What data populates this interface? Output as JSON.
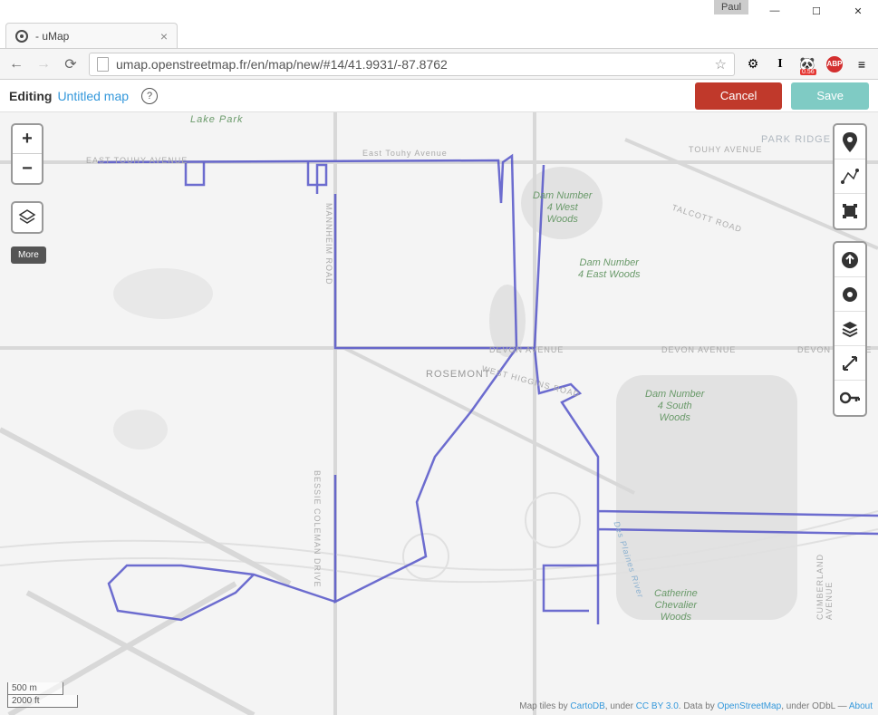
{
  "window": {
    "user_tag": "Paul",
    "tab_title": "- uMap",
    "url": "umap.openstreetmap.fr/en/map/new/#14/41.9931/-87.8762",
    "panda_badge": "0.56",
    "abp_text": "ABP"
  },
  "header": {
    "editing_label": "Editing",
    "map_name": "Untitled map",
    "help": "?",
    "cancel": "Cancel",
    "save": "Save"
  },
  "zoom": {
    "in": "+",
    "out": "−"
  },
  "more_label": "More",
  "scale": {
    "metric": "500 m",
    "imperial": "2000 ft"
  },
  "attribution": {
    "prefix": "Map tiles by ",
    "p1": "CartoDB",
    "mid1": ", under ",
    "p2": "CC BY 3.0",
    "mid2": ". Data by ",
    "p3": "OpenStreetMap",
    "mid3": ", under ODbL — ",
    "p4": "About"
  },
  "map_labels": {
    "park_ridge": "PARK RIDGE",
    "rosemont": "ROSEMONT",
    "dam4w": "Dam Number\n4 West\nWoods",
    "dam4e": "Dam Number\n4 East Woods",
    "dam4s": "Dam Number\n4 South\nWoods",
    "catherine": "Catherine\nChevalier\nWoods",
    "lake_park": "Lake Park",
    "touhy_e": "EAST TOUHY AVENUE",
    "touhy_e2": "East Touhy Avenue",
    "touhy": "TOUHY AVENUE",
    "devon": "DEVON AVENUE",
    "devon2": "DEVON AVENUE",
    "talcott": "TALCOTT ROAD",
    "mannheim": "MANNHEIM ROAD",
    "higgins": "WEST HIGGINS ROAD",
    "bessie": "BESSIE COLEMAN DRIVE",
    "desplaines": "Des Plaines River",
    "cumberland": "CUMBERLAND AVENUE"
  }
}
